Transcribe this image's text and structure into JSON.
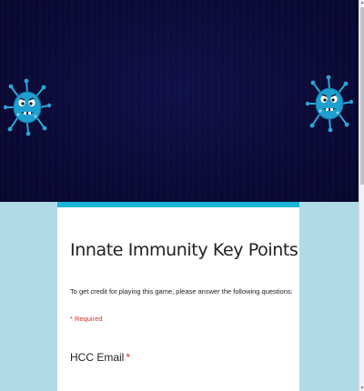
{
  "form": {
    "title": "Innate Immunity Key Points",
    "description": "To get credit for playing this game, please answer the following questions:",
    "required_note": "* Required",
    "questions": [
      {
        "label": "HCC Email",
        "required_marker": "*"
      }
    ]
  },
  "banner": {
    "background_color": "#0b0a3b",
    "decorations": [
      "germ-icon",
      "germ-icon"
    ]
  },
  "theme": {
    "accent": "#1bb4da",
    "page_background": "#b0dbe6",
    "required_color": "#d93025"
  }
}
